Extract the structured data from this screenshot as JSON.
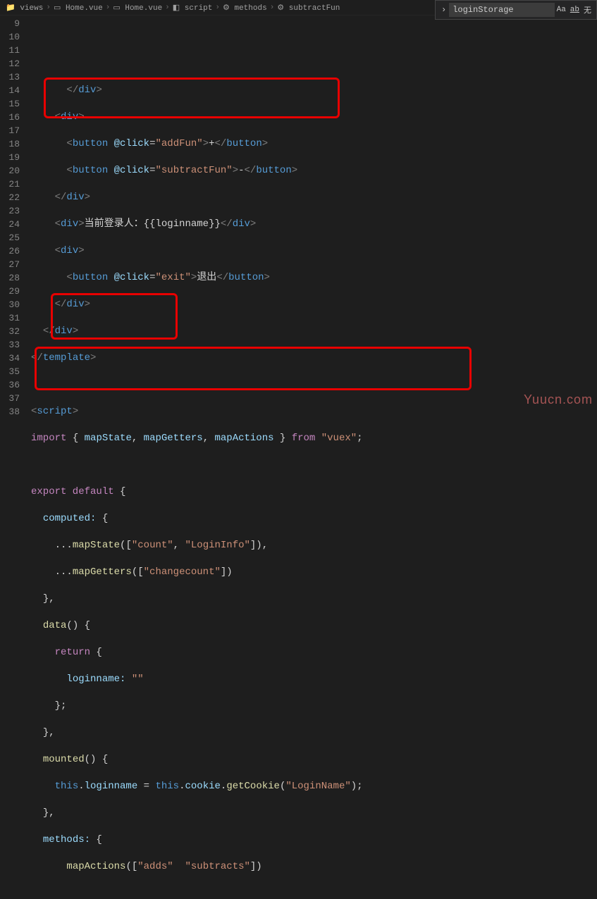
{
  "breadcrumb": {
    "items": [
      "views",
      "Home.vue",
      "Home.vue",
      "script",
      "methods",
      "subtractFun"
    ]
  },
  "search": {
    "value": "loginStorage",
    "opt_aa": "Aa",
    "opt_ab": "ab",
    "opt_cn": "无"
  },
  "gutter": [
    "9",
    "10",
    "11",
    "12",
    "13",
    "14",
    "15",
    "16",
    "17",
    "18",
    "19",
    "20",
    "21",
    "22",
    "23",
    "24",
    "25",
    "26",
    "27",
    "28",
    "29",
    "30",
    "31",
    "32",
    "33",
    "34",
    "35",
    "36",
    "37",
    "38"
  ],
  "code": {
    "l9a": "</",
    "l9b": "div",
    "l9c": ">",
    "l10a": "<",
    "l10b": "div",
    "l10c": ">",
    "l11a": "<",
    "l11b": "button",
    "l11c": "@click",
    "l11d": "=",
    "l11e": "\"addFun\"",
    "l11f": ">",
    "l11g": "+",
    "l11h": "</",
    "l11i": "button",
    "l11j": ">",
    "l12a": "<",
    "l12b": "button",
    "l12c": "@click",
    "l12d": "=",
    "l12e": "\"subtractFun\"",
    "l12f": ">",
    "l12g": "-",
    "l12h": "</",
    "l12i": "button",
    "l12j": ">",
    "l13a": "</",
    "l13b": "div",
    "l13c": ">",
    "l14a": "<",
    "l14b": "div",
    "l14c": ">",
    "l14d": "当前登录人：",
    "l14e": "{{",
    "l14f": "loginname",
    "l14g": "}}",
    "l14h": "</",
    "l14i": "div",
    "l14j": ">",
    "l15a": "<",
    "l15b": "div",
    "l15c": ">",
    "l16a": "<",
    "l16b": "button",
    "l16c": "@click",
    "l16d": "=",
    "l16e": "\"exit\"",
    "l16f": ">",
    "l16g": "退出",
    "l16h": "</",
    "l16i": "button",
    "l16j": ">",
    "l17a": "</",
    "l17b": "div",
    "l17c": ">",
    "l18a": "</",
    "l18b": "div",
    "l18c": ">",
    "l19a": "</",
    "l19b": "template",
    "l19c": ">",
    "l21a": "<",
    "l21b": "script",
    "l21c": ">",
    "l22a": "import",
    "l22b": "{ ",
    "l22c": "mapState",
    "l22d": ", ",
    "l22e": "mapGetters",
    "l22f": ", ",
    "l22g": "mapActions",
    "l22h": " }",
    "l22i": " from ",
    "l22j": "\"vuex\"",
    "l22k": ";",
    "l24a": "export default",
    "l24b": " {",
    "l25a": "computed:",
    "l25b": " {",
    "l26a": "...",
    "l26b": "mapState",
    "l26c": "([",
    "l26d": "\"count\"",
    "l26e": ", ",
    "l26f": "\"LoginInfo\"",
    "l26g": "]),",
    "l27a": "...",
    "l27b": "mapGetters",
    "l27c": "([",
    "l27d": "\"changecount\"",
    "l27e": "])",
    "l28a": "},",
    "l29a": "data",
    "l29b": "() {",
    "l30a": "return",
    "l30b": " {",
    "l31a": "loginname:",
    "l31b": " ",
    "l31c": "\"\"",
    "l32a": "};",
    "l33a": "},",
    "l34a": "mounted",
    "l34b": "() {",
    "l35a": "this",
    "l35b": ".",
    "l35c": "loginname",
    "l35d": " = ",
    "l35e": "this",
    "l35f": ".",
    "l35g": "cookie",
    "l35h": ".",
    "l35i": "getCookie",
    "l35j": "(",
    "l35k": "\"LoginName\"",
    "l35l": ");",
    "l36a": "},",
    "l37a": "methods:",
    "l37b": " {",
    "l38a": "mapActions",
    "l38b": "([",
    "l38c": "\"adds\"",
    "l38d": "  ",
    "l38e": "\"subtracts\"",
    "l38f": "])"
  },
  "watermark": "Yuucn.com"
}
